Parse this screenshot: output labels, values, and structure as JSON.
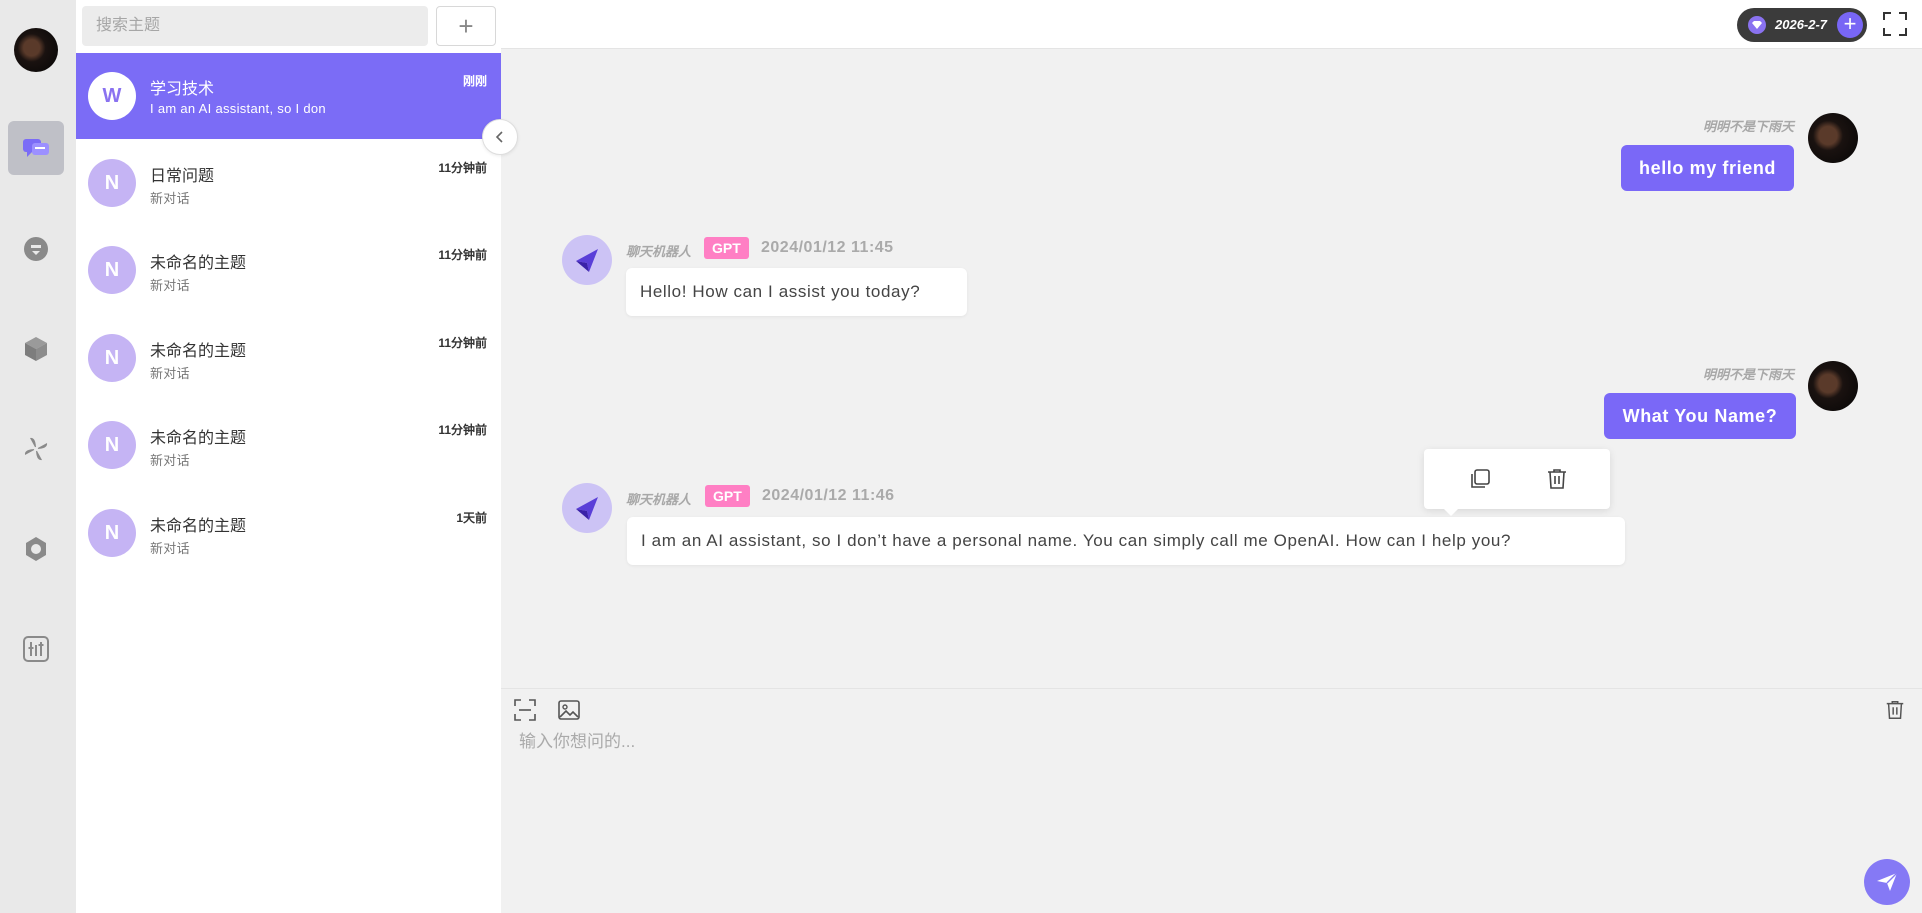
{
  "rail": {
    "items": [
      {
        "name": "chat",
        "icon": "chat-icon",
        "active": true
      },
      {
        "name": "prompt",
        "icon": "prompt-icon",
        "active": false
      },
      {
        "name": "plugin",
        "icon": "cube-icon",
        "active": false
      },
      {
        "name": "draw",
        "icon": "pinwheel-icon",
        "active": false
      },
      {
        "name": "settings",
        "icon": "gear-icon",
        "active": false
      },
      {
        "name": "params",
        "icon": "sliders-icon",
        "active": false
      }
    ]
  },
  "topics": {
    "search_placeholder": "搜索主题",
    "add_label": "+",
    "list": [
      {
        "avatar": "W",
        "title": "学习技术",
        "subtitle": "I am an AI assistant, so I don",
        "time": "刚刚",
        "active": true
      },
      {
        "avatar": "N",
        "title": "日常问题",
        "subtitle": "新对话",
        "time": "11分钟前",
        "active": false
      },
      {
        "avatar": "N",
        "title": "未命名的主题",
        "subtitle": "新对话",
        "time": "11分钟前",
        "active": false
      },
      {
        "avatar": "N",
        "title": "未命名的主题",
        "subtitle": "新对话",
        "time": "11分钟前",
        "active": false
      },
      {
        "avatar": "N",
        "title": "未命名的主题",
        "subtitle": "新对话",
        "time": "11分钟前",
        "active": false
      },
      {
        "avatar": "N",
        "title": "未命名的主题",
        "subtitle": "新对话",
        "time": "1天前",
        "active": false
      }
    ]
  },
  "header": {
    "date": "2026-2-7",
    "plus": "+"
  },
  "messages": [
    {
      "role": "user",
      "name": "明明不是下雨天",
      "text": "hello my friend"
    },
    {
      "role": "bot",
      "name": "聊天机器人",
      "tag": "GPT",
      "time": "2024/01/12 11:45",
      "text": "Hello! How can I assist you today?"
    },
    {
      "role": "user",
      "name": "明明不是下雨天",
      "text": "What You Name?"
    },
    {
      "role": "bot",
      "name": "聊天机器人",
      "tag": "GPT",
      "time": "2024/01/12 11:46",
      "text": "I am an AI assistant, so I don’t have a personal name. You can simply call me OpenAI. How can I help you?"
    }
  ],
  "composer": {
    "placeholder": "输入你想问的..."
  },
  "colors": {
    "accent": "#7b6cf6",
    "gpt_tag": "#ff7fc4",
    "topic_avatar": "#c5b4f4"
  }
}
